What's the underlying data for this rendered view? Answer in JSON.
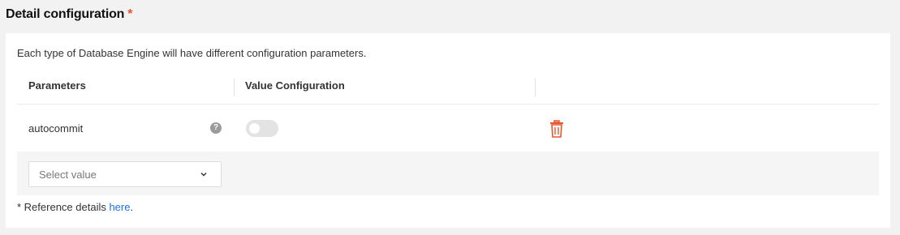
{
  "section": {
    "title": "Detail configuration",
    "required_mark": "*"
  },
  "card": {
    "description": "Each type of Database Engine will have different configuration parameters."
  },
  "table": {
    "headers": [
      "Parameters",
      "Value Configuration"
    ],
    "rows": [
      {
        "parameter": "autocommit",
        "help_icon": "?",
        "toggle_on": false
      }
    ]
  },
  "select": {
    "placeholder": "Select value"
  },
  "reference": {
    "prefix": "* Reference details ",
    "link": "here",
    "suffix": "."
  },
  "colors": {
    "accent_required": "#e8552b",
    "delete_icon": "#e8552b",
    "link": "#1a73e8"
  },
  "icons": {
    "help": "question-circle-icon",
    "delete": "trash-icon",
    "dropdown": "chevron-down-icon"
  }
}
